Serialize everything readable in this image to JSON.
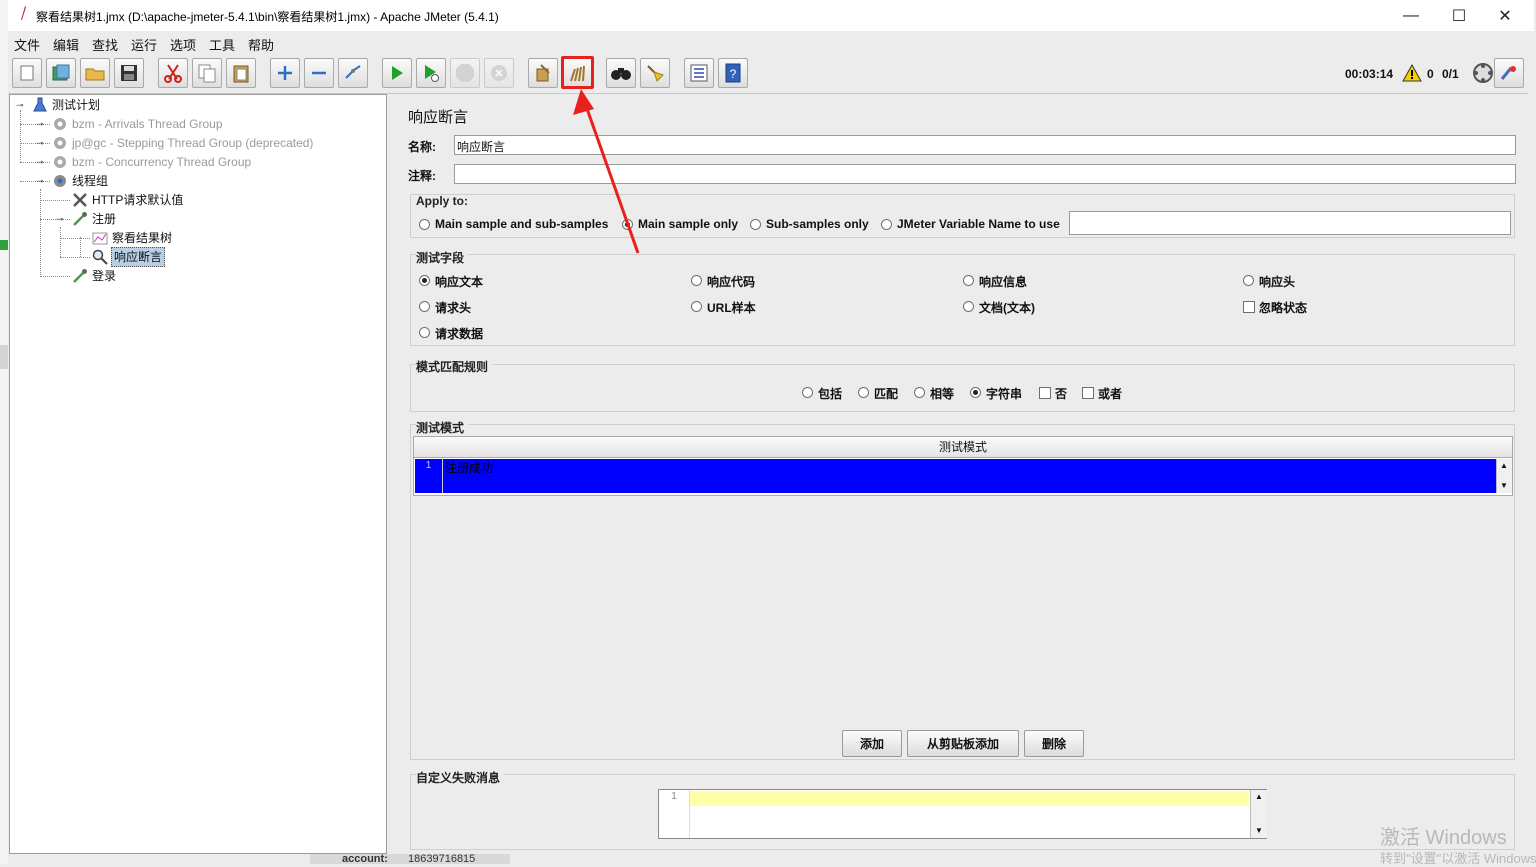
{
  "window": {
    "title": "察看结果树1.jmx (D:\\apache-jmeter-5.4.1\\bin\\察看结果树1.jmx) - Apache JMeter (5.4.1)",
    "minimize_glyph": "—",
    "maximize_glyph": "☐",
    "close_glyph": "✕"
  },
  "menu": [
    "文件",
    "编辑",
    "查找",
    "运行",
    "选项",
    "工具",
    "帮助"
  ],
  "toolbar": {
    "buttons": [
      "new-icon",
      "templates-icon",
      "open-icon",
      "save-icon",
      "cut-icon",
      "copy-icon",
      "paste-icon",
      "expand-icon",
      "collapse-icon",
      "toggle-icon",
      "start-icon",
      "start-no-pause-icon",
      "stop-icon",
      "shutdown-icon",
      "clear-icon",
      "clear-all-icon",
      "search-icon",
      "reset-search-icon",
      "function-helper-icon",
      "help-icon"
    ],
    "elapsed_time": "00:03:14",
    "warning_count": "0",
    "thread_count": "0/1"
  },
  "tree": {
    "test_plan": "测试计划",
    "arrivals": "bzm - Arrivals Thread Group",
    "stepping": "jp@gc - Stepping Thread Group (deprecated)",
    "concurrency": "bzm - Concurrency Thread Group",
    "thread_group": "线程组",
    "http_defaults": "HTTP请求默认值",
    "register": "注册",
    "result_tree": "察看结果树",
    "response_assertion": "响应断言",
    "login": "登录"
  },
  "assertion": {
    "heading": "响应断言",
    "name_label": "名称:",
    "name_value": "响应断言",
    "comment_label": "注释:",
    "comment_value": "",
    "apply_to": {
      "title": "Apply to:",
      "options": [
        "Main sample and sub-samples",
        "Main sample only",
        "Sub-samples only",
        "JMeter Variable Name to use"
      ],
      "selected": "Main sample only",
      "variable_value": ""
    },
    "test_field": {
      "title": "测试字段",
      "options": [
        "响应文本",
        "响应代码",
        "响应信息",
        "响应头",
        "请求头",
        "URL样本",
        "文档(文本)",
        "忽略状态",
        "请求数据"
      ],
      "selected": "响应文本"
    },
    "matching_rules": {
      "title": "模式匹配规则",
      "options": [
        "包括",
        "匹配",
        "相等",
        "字符串",
        "否",
        "或者"
      ],
      "selected": "字符串"
    },
    "patterns": {
      "title": "测试模式",
      "column_header": "测试模式",
      "rows": [
        {
          "line": "1",
          "value": "注册成功"
        }
      ]
    },
    "buttons": {
      "add": "添加",
      "add_clipboard": "从剪贴板添加",
      "delete": "删除"
    },
    "custom_failure": {
      "title": "自定义失败消息",
      "line": "1",
      "value": ""
    }
  },
  "background": {
    "account_label": "account:",
    "account_value": "18639716815"
  },
  "watermark": {
    "line1": "激活 Windows",
    "line2": "转到\"设置\"以激活 Windows。"
  },
  "colors": {
    "selection": "#0000ff",
    "highlight_box": "#e8211d",
    "editor_line": "#ffffa8"
  }
}
